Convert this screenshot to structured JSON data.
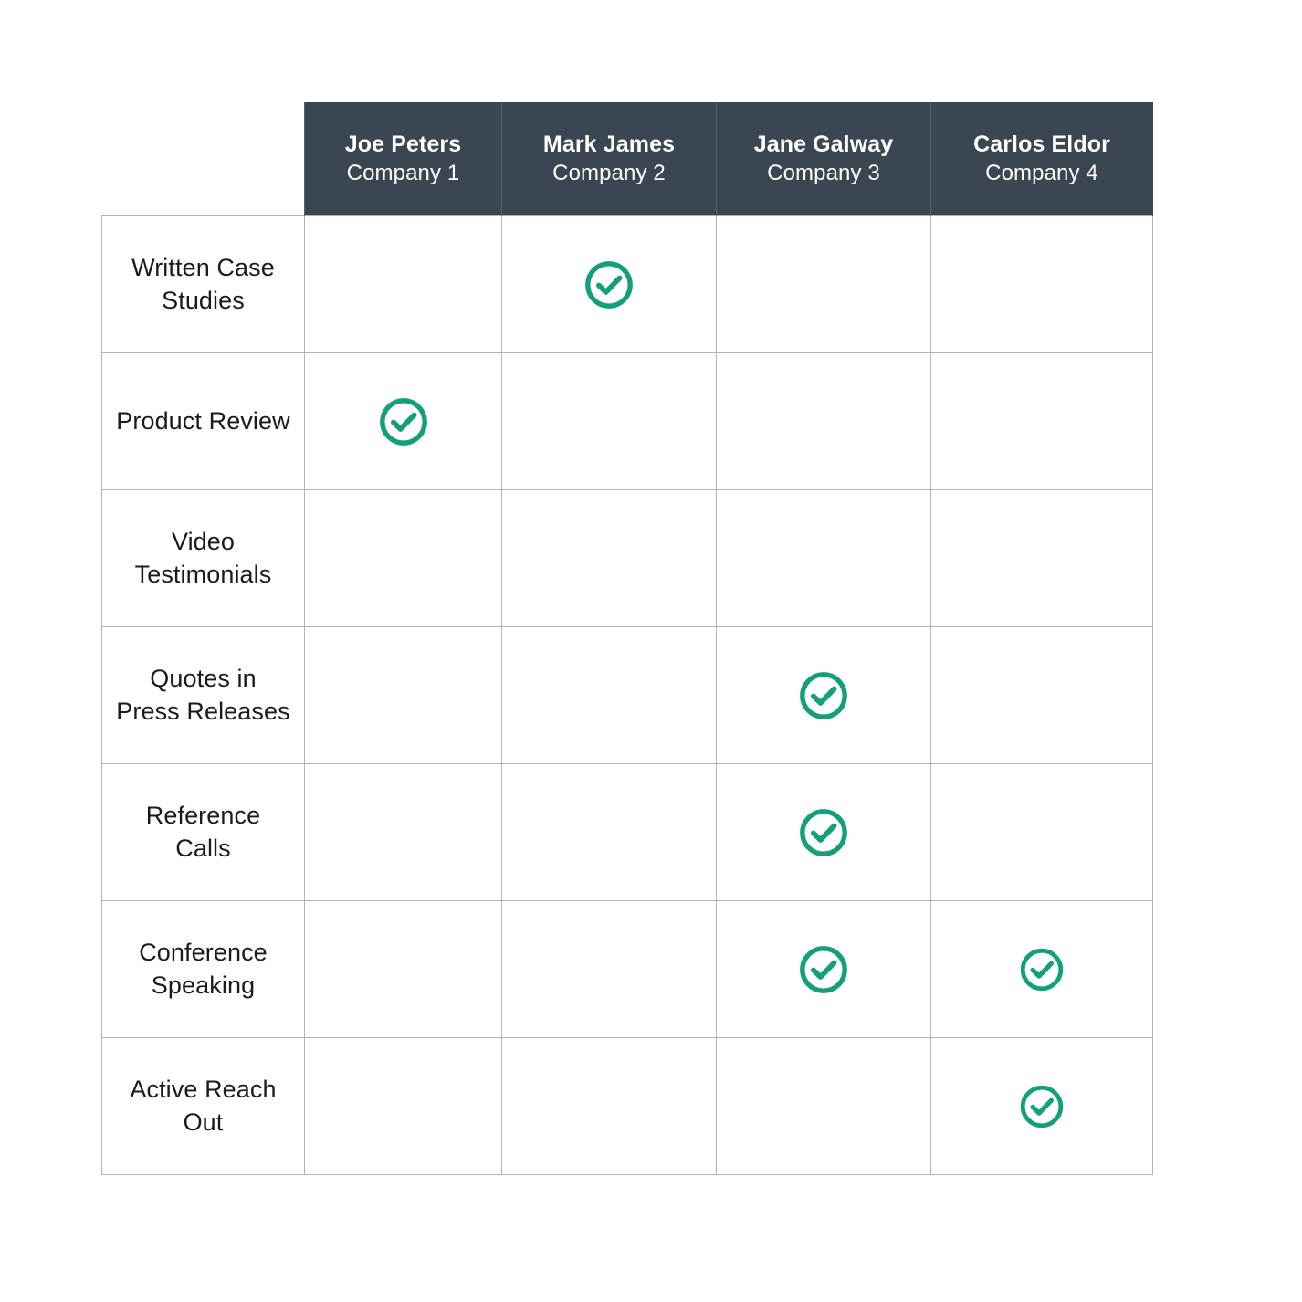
{
  "table": {
    "accent_color": "#12a078",
    "header_bg": "#3a4651",
    "header_text_color": "#ffffff",
    "border_color": "#b2b2b2",
    "cell_text_color": "#1b1b1b",
    "corner_label": "",
    "columns": [
      {
        "name": "Joe Peters",
        "company": "Company 1"
      },
      {
        "name": "Mark James",
        "company": "Company 2"
      },
      {
        "name": "Jane Galway",
        "company": "Company 3"
      },
      {
        "name": "Carlos Eldor",
        "company": "Company 4"
      }
    ],
    "rows": [
      {
        "label": "Written Case Studies",
        "cells": [
          {
            "checked": false,
            "icon": ""
          },
          {
            "checked": true,
            "icon": "check-circle-icon",
            "size": "size-lg"
          },
          {
            "checked": false,
            "icon": ""
          },
          {
            "checked": false,
            "icon": ""
          }
        ]
      },
      {
        "label": "Product Review",
        "cells": [
          {
            "checked": true,
            "icon": "check-circle-icon",
            "size": "size-lg"
          },
          {
            "checked": false,
            "icon": ""
          },
          {
            "checked": false,
            "icon": ""
          },
          {
            "checked": false,
            "icon": ""
          }
        ]
      },
      {
        "label": "Video Testimonials",
        "cells": [
          {
            "checked": false,
            "icon": ""
          },
          {
            "checked": false,
            "icon": ""
          },
          {
            "checked": false,
            "icon": ""
          },
          {
            "checked": false,
            "icon": ""
          }
        ]
      },
      {
        "label": "Quotes in Press Releases",
        "cells": [
          {
            "checked": false,
            "icon": ""
          },
          {
            "checked": false,
            "icon": ""
          },
          {
            "checked": true,
            "icon": "check-circle-icon",
            "size": "size-lg"
          },
          {
            "checked": false,
            "icon": ""
          }
        ]
      },
      {
        "label": "Reference Calls",
        "cells": [
          {
            "checked": false,
            "icon": ""
          },
          {
            "checked": false,
            "icon": ""
          },
          {
            "checked": true,
            "icon": "check-circle-icon",
            "size": "size-lg"
          },
          {
            "checked": false,
            "icon": ""
          }
        ]
      },
      {
        "label": "Conference Speaking",
        "cells": [
          {
            "checked": false,
            "icon": ""
          },
          {
            "checked": false,
            "icon": ""
          },
          {
            "checked": true,
            "icon": "check-circle-icon",
            "size": "size-lg"
          },
          {
            "checked": true,
            "icon": "check-circle-icon",
            "size": "size-sm"
          }
        ]
      },
      {
        "label": "Active Reach Out",
        "cells": [
          {
            "checked": false,
            "icon": ""
          },
          {
            "checked": false,
            "icon": ""
          },
          {
            "checked": false,
            "icon": ""
          },
          {
            "checked": true,
            "icon": "check-circle-icon",
            "size": "size-sm"
          }
        ]
      }
    ]
  }
}
